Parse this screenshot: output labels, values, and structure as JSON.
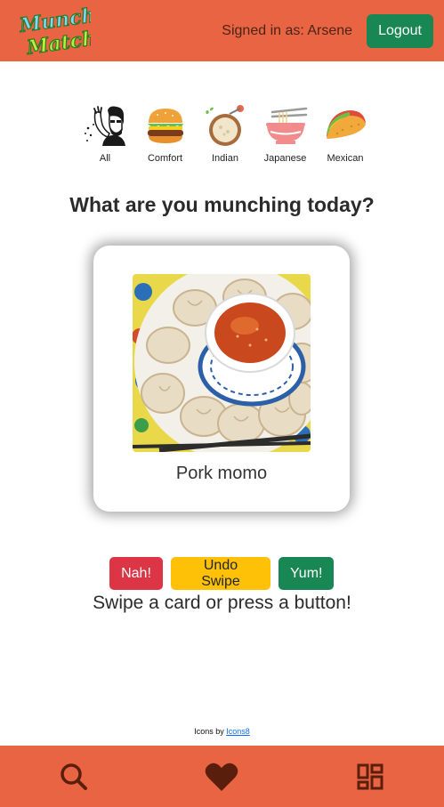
{
  "header": {
    "logo_line1": "Munch",
    "logo_line2": "Match",
    "signed_in_text": "Signed in as: Arsene",
    "logout_label": "Logout"
  },
  "categories": [
    {
      "label": "All",
      "icon": "person-eating-icon"
    },
    {
      "label": "Comfort",
      "icon": "burger-icon"
    },
    {
      "label": "Indian",
      "icon": "curry-bowl-icon"
    },
    {
      "label": "Japanese",
      "icon": "ramen-bowl-icon"
    },
    {
      "label": "Mexican",
      "icon": "taco-icon"
    }
  ],
  "heading": "What are you munching today?",
  "card": {
    "food_name": "Pork momo",
    "image": "pork-momo-photo"
  },
  "actions": {
    "nah_label": "Nah!",
    "undo_label": "Undo Swipe",
    "yum_label": "Yum!"
  },
  "instructions": "Swipe a card or press a button!",
  "attribution": {
    "prefix": "Icons by ",
    "link_text": "Icons8"
  },
  "bottom_nav": [
    {
      "icon": "search-icon"
    },
    {
      "icon": "heart-icon"
    },
    {
      "icon": "dashboard-icon"
    }
  ],
  "colors": {
    "brand": "#e96443",
    "success": "#198754",
    "danger": "#dc3545",
    "warning": "#ffc107",
    "nav_icon": "#5a1e0c"
  }
}
